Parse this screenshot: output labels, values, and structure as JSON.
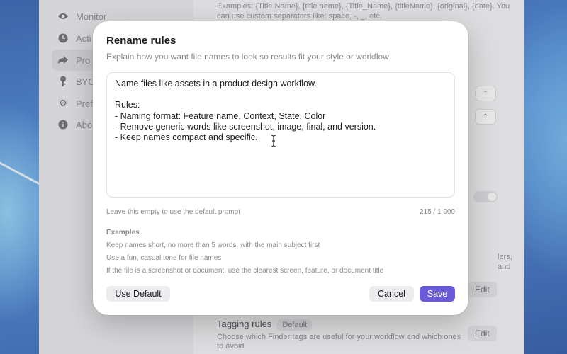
{
  "background_app": {
    "sidebar": {
      "items": [
        {
          "label": "Monitor",
          "icon": "eye-icon"
        },
        {
          "label": "Acti",
          "icon": "clock-icon"
        },
        {
          "label": "Pro",
          "icon": "arrow-right-icon"
        },
        {
          "label": "BYO",
          "icon": "key-icon"
        },
        {
          "label": "Pref",
          "icon": "gear-icon"
        },
        {
          "label": "Abo",
          "icon": "info-icon"
        }
      ]
    },
    "main": {
      "examples_line1": "Examples: {Title Name}, {title name}, {Title_Name}, {titleName}, {original}, {date}. You",
      "examples_line2": "can use custom separators like: space, -, _, etc.",
      "right_edge_text": "lers, and",
      "edit_label": "Edit",
      "tagging_title": "Tagging rules",
      "tagging_badge": "Default",
      "tagging_desc_line1": "Choose which Finder tags are useful for your workflow and which ones",
      "tagging_desc_line2": "to avoid",
      "select_char": "D"
    }
  },
  "dialog": {
    "title": "Rename rules",
    "subtitle": "Explain how you want file names to look so results fit your style or workflow",
    "prompt_text": "Name files like assets in a product design workflow.\n\nRules:\n- Naming format: Feature name, Context, State, Color\n- Remove generic words like screenshot, image, final, and version.\n- Keep names compact and specific.",
    "helper_text": "Leave this empty to use the default prompt",
    "counter": "215 / 1 000",
    "examples_heading": "Examples",
    "examples": [
      "Keep names short, no more than 5 words, with the main subject first",
      "Use a fun, casual tone for file names",
      "If the file is a screenshot or document, use the clearest screen, feature, or document title"
    ],
    "buttons": {
      "use_default": "Use Default",
      "cancel": "Cancel",
      "save": "Save"
    }
  },
  "colors": {
    "accent": "#6a5bd8"
  }
}
